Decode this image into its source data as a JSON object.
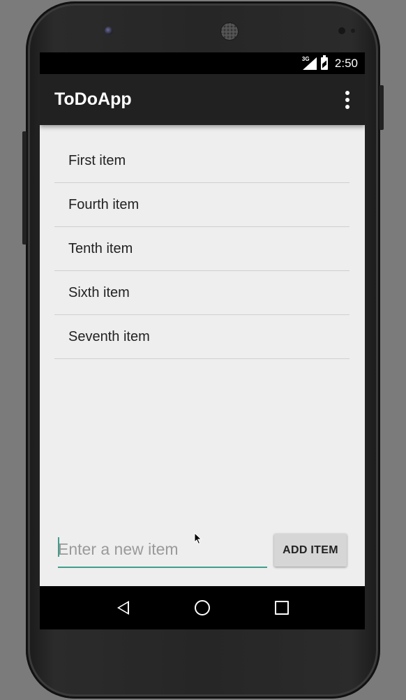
{
  "status_bar": {
    "network": "3G",
    "time": "2:50"
  },
  "app_bar": {
    "title": "ToDoApp"
  },
  "items": [
    "First item",
    "Fourth item",
    "Tenth item",
    "Sixth item",
    "Seventh item"
  ],
  "new_item": {
    "placeholder": "Enter a new item",
    "value": ""
  },
  "add_button": {
    "label": "ADD ITEM"
  },
  "colors": {
    "accent": "#3f9e8c",
    "app_bar": "#212121",
    "background": "#eeeeee"
  },
  "icons": {
    "overflow": "more-vert-icon",
    "back": "back-icon",
    "home": "home-icon",
    "recent": "recent-apps-icon"
  }
}
